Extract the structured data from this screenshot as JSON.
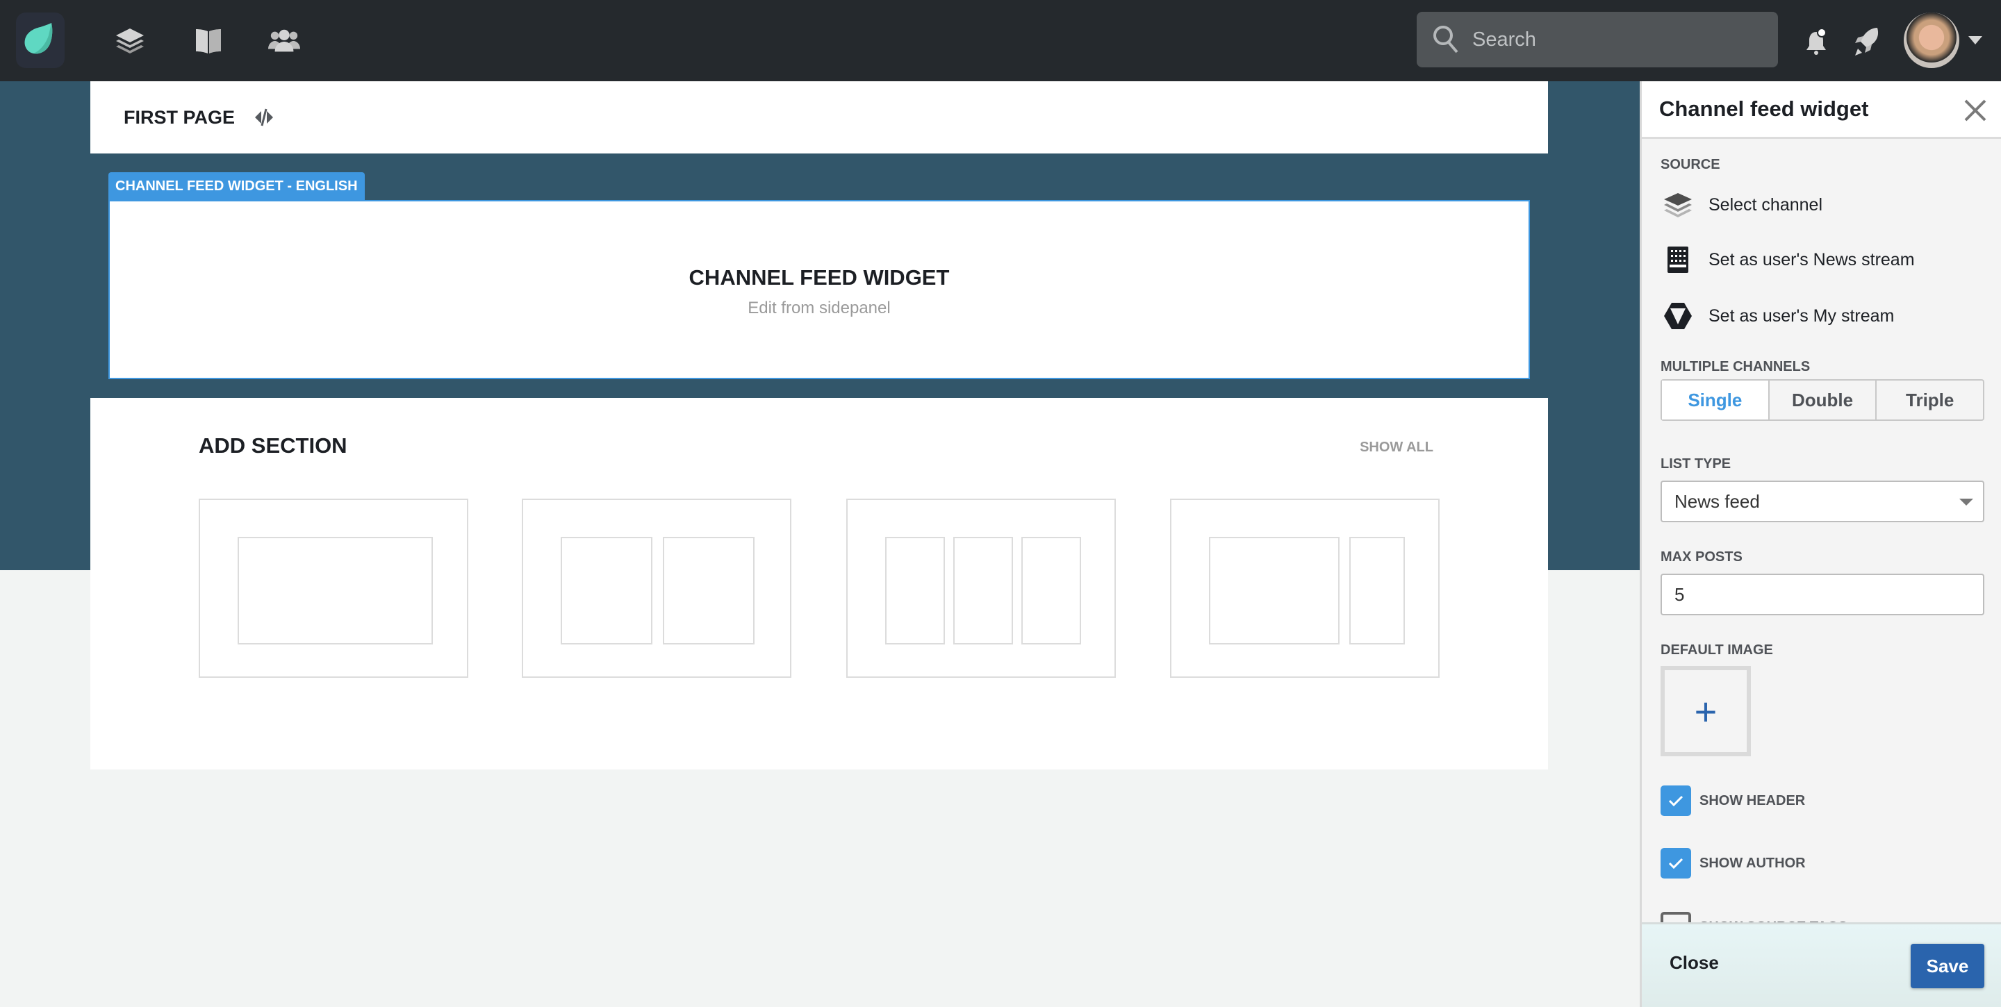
{
  "topbar": {
    "search_placeholder": "Search",
    "icons": [
      "app-logo",
      "channels-layers-icon",
      "book-icon",
      "people-icon",
      "bell-icon",
      "rocket-icon",
      "avatar",
      "chevron-down-icon"
    ]
  },
  "page": {
    "title": "FIRST PAGE"
  },
  "widget": {
    "tag": "CHANNEL FEED WIDGET - ENGLISH",
    "title": "CHANNEL FEED WIDGET",
    "subtitle": "Edit from sidepanel"
  },
  "add_section": {
    "title": "ADD SECTION",
    "show_all": "SHOW ALL",
    "layouts": [
      "one-column",
      "two-columns",
      "three-columns",
      "wide-narrow"
    ]
  },
  "panel": {
    "title": "Channel feed widget",
    "source_label": "SOURCE",
    "sources": [
      "Select channel",
      "Set as user's News stream",
      "Set as user's My stream"
    ],
    "multiple_label": "MULTIPLE CHANNELS",
    "multiple_options": [
      "Single",
      "Double",
      "Triple"
    ],
    "multiple_selected": "Single",
    "list_type_label": "LIST TYPE",
    "list_type_value": "News feed",
    "max_posts_label": "MAX POSTS",
    "max_posts_value": "5",
    "default_image_label": "DEFAULT IMAGE",
    "checkboxes": [
      {
        "label": "SHOW HEADER",
        "checked": true
      },
      {
        "label": "SHOW AUTHOR",
        "checked": true
      },
      {
        "label": "SHOW SOURCE TAGS",
        "checked": false
      }
    ],
    "close_label": "Close",
    "save_label": "Save"
  },
  "colors": {
    "topbar": "#25292d",
    "stage": "#32566a",
    "accent": "#3e97e0",
    "save": "#2a64ad"
  }
}
